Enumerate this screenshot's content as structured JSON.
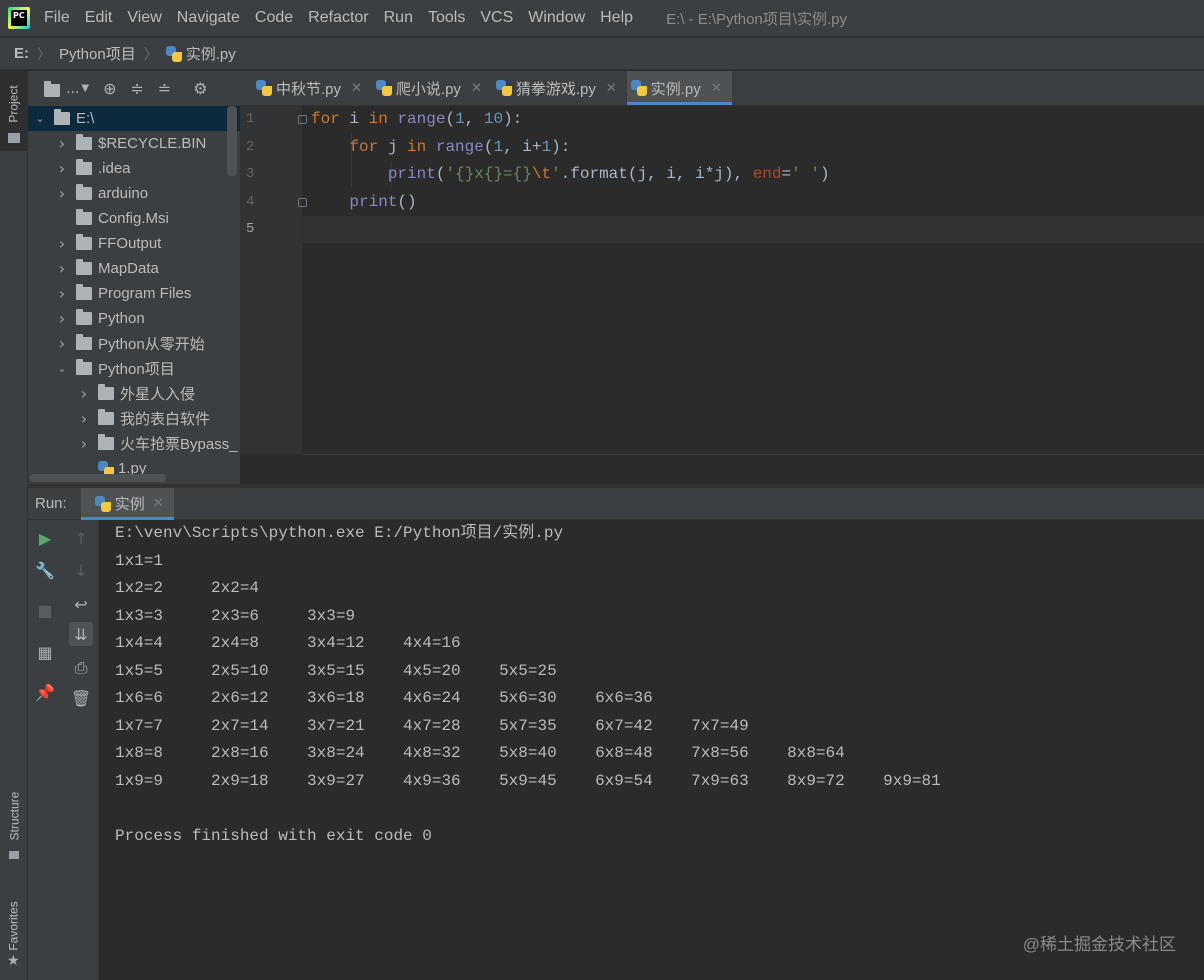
{
  "menubar": {
    "logo_text": "PC",
    "items": [
      "File",
      "Edit",
      "View",
      "Navigate",
      "Code",
      "Refactor",
      "Run",
      "Tools",
      "VCS",
      "Window",
      "Help"
    ],
    "window_title": "E:\\ - E:\\Python项目\\实例.py"
  },
  "breadcrumb": {
    "items": [
      "E:",
      "Python项目",
      "实例.py"
    ]
  },
  "left_strip": {
    "project_tab": "Project",
    "structure_tab": "Structure",
    "favorites_tab": "Favorites"
  },
  "project_toolbar": {
    "view_selector": "..."
  },
  "project_tree": {
    "root": "E:\\",
    "items": [
      {
        "label": "$RECYCLE.BIN",
        "depth": 1,
        "expanded": false,
        "has_arrow": true
      },
      {
        "label": ".idea",
        "depth": 1,
        "expanded": false,
        "has_arrow": true
      },
      {
        "label": "arduino",
        "depth": 1,
        "expanded": false,
        "has_arrow": true
      },
      {
        "label": "Config.Msi",
        "depth": 1,
        "expanded": false,
        "has_arrow": false
      },
      {
        "label": "FFOutput",
        "depth": 1,
        "expanded": false,
        "has_arrow": true
      },
      {
        "label": "MapData",
        "depth": 1,
        "expanded": false,
        "has_arrow": true
      },
      {
        "label": "Program Files",
        "depth": 1,
        "expanded": false,
        "has_arrow": true
      },
      {
        "label": "Python",
        "depth": 1,
        "expanded": false,
        "has_arrow": true
      },
      {
        "label": "Python从零开始",
        "depth": 1,
        "expanded": false,
        "has_arrow": true
      },
      {
        "label": "Python项目",
        "depth": 1,
        "expanded": true,
        "has_arrow": true
      },
      {
        "label": "外星人入侵",
        "depth": 2,
        "expanded": false,
        "has_arrow": true
      },
      {
        "label": "我的表白软件",
        "depth": 2,
        "expanded": false,
        "has_arrow": true
      },
      {
        "label": "火车抢票Bypass_",
        "depth": 2,
        "expanded": false,
        "has_arrow": true
      },
      {
        "label": "1.py",
        "depth": 2,
        "expanded": false,
        "has_arrow": false,
        "file": true
      }
    ]
  },
  "editor_tabs": [
    {
      "label": "中秋节.py",
      "active": false
    },
    {
      "label": "爬小说.py",
      "active": false
    },
    {
      "label": "猜拳游戏.py",
      "active": false
    },
    {
      "label": "实例.py",
      "active": true
    }
  ],
  "editor": {
    "line_numbers": [
      "1",
      "2",
      "3",
      "4",
      "5"
    ],
    "current_line": 5
  },
  "run_panel": {
    "label": "Run:",
    "tab_label": "实例"
  },
  "console": {
    "lines": [
      "E:\\venv\\Scripts\\python.exe E:/Python项目/实例.py",
      "1x1=1\t",
      "1x2=2\t2x2=4\t",
      "1x3=3\t2x3=6\t3x3=9\t",
      "1x4=4\t2x4=8\t3x4=12\t4x4=16\t",
      "1x5=5\t2x5=10\t3x5=15\t4x5=20\t5x5=25\t",
      "1x6=6\t2x6=12\t3x6=18\t4x6=24\t5x6=30\t6x6=36\t",
      "1x7=7\t2x7=14\t3x7=21\t4x7=28\t5x7=35\t6x7=42\t7x7=49\t",
      "1x8=8\t2x8=16\t3x8=24\t4x8=32\t5x8=40\t6x8=48\t7x8=56\t8x8=64\t",
      "1x9=9\t2x9=18\t3x9=27\t4x9=36\t5x9=45\t6x9=54\t7x9=63\t8x9=72\t9x9=81\t",
      "",
      "Process finished with exit code 0"
    ]
  },
  "watermark": "@稀土掘金技术社区",
  "colors": {
    "background": "#2b2b2b",
    "panel": "#3c3f41",
    "accent": "#4a88c7",
    "keyword": "#cc7832",
    "builtin": "#8888c6",
    "number": "#6897bb",
    "string": "#6a8759",
    "param": "#aa4926"
  }
}
